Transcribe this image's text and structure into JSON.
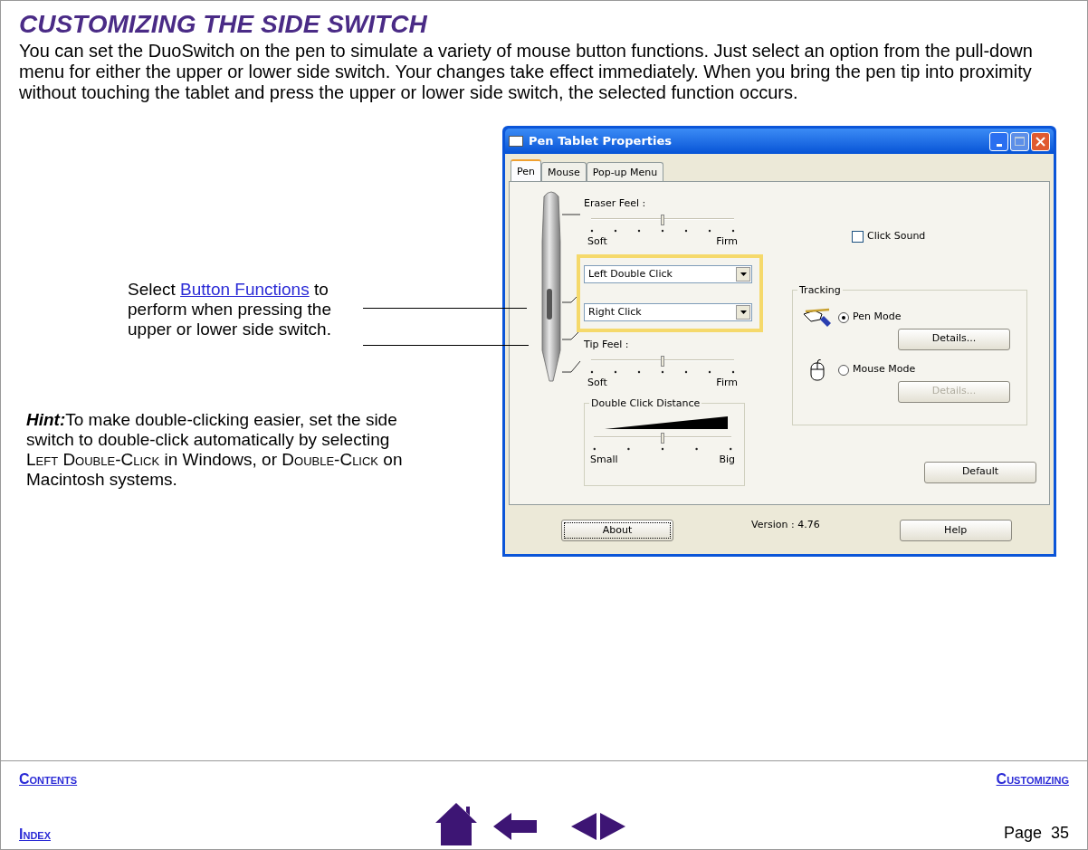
{
  "title": "CUSTOMIZING THE SIDE SWITCH",
  "intro": "You can set the DuoSwitch on the pen to simulate a variety of mouse button functions.  Just select an option from the pull-down menu for either the upper or lower side switch.  Your changes take effect immediately.  When you bring the pen tip into proximity without touching the tablet and press the upper or lower side switch, the selected function occurs.",
  "callout": {
    "segments": [
      {
        "kind": "plain",
        "text": "Select "
      },
      {
        "kind": "link",
        "text": "Button Functions"
      },
      {
        "kind": "plain",
        "text": " to perform when pressing  the upper or lower side switch."
      }
    ]
  },
  "hint": {
    "segments": [
      {
        "kind": "bold",
        "text": "Hint:"
      },
      {
        "kind": "plain",
        "text": "To make double-clicking easier, set the side switch to double-click automatically by selecting "
      },
      {
        "kind": "smallcaps",
        "text": "Left Double-Click"
      },
      {
        "kind": "plain",
        "text": " in Windows, or "
      },
      {
        "kind": "smallcaps",
        "text": "Double-Click"
      },
      {
        "kind": "plain",
        "text": " on Macintosh systems."
      }
    ]
  },
  "dialog": {
    "title": "Pen Tablet Properties",
    "tabs": [
      {
        "label": "Pen",
        "selected": true
      },
      {
        "label": "Mouse",
        "selected": false
      },
      {
        "label": "Pop-up Menu",
        "selected": false
      }
    ],
    "eraser_feel": {
      "label": "Eraser Feel :",
      "level": 0.5,
      "min_label": "Soft",
      "max_label": "Firm"
    },
    "side_switches": [
      {
        "value": "Left Double Click"
      },
      {
        "value": "Right Click"
      }
    ],
    "tip_feel": {
      "label": "Tip Feel :",
      "level": 0.5,
      "min_label": "Soft",
      "max_label": "Firm"
    },
    "double_click_distance": {
      "label": "Double Click Distance",
      "level": 0.5,
      "min_label": "Small",
      "max_label": "Big"
    },
    "click_sound": {
      "label": "Click Sound",
      "checked": false
    },
    "tracking": {
      "label": "Tracking",
      "modes": [
        {
          "kind": "pen",
          "label": "Pen Mode",
          "selected": true,
          "details": {
            "label": "Details...",
            "disabled": false
          }
        },
        {
          "kind": "mouse",
          "label": "Mouse Mode",
          "selected": false,
          "details": {
            "label": "Details...",
            "disabled": true
          }
        }
      ]
    },
    "default_button": "Default",
    "about_button": "About",
    "version": "Version : 4.76",
    "help_button": "Help"
  },
  "footer": {
    "contents": "Contents",
    "customizing": "Customizing",
    "index": "Index",
    "page": "Page  35"
  }
}
